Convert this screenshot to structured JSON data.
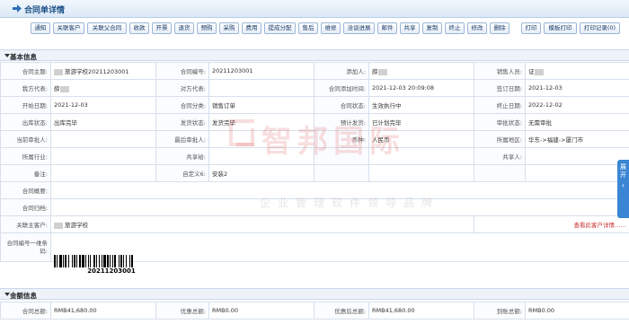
{
  "header": {
    "title": "合同单详情"
  },
  "toolbar": {
    "buttons": [
      "通知",
      "关联客户",
      "关联父合同",
      "收款",
      "开票",
      "退货",
      "预购",
      "采购",
      "费用",
      "提成分配",
      "售后",
      "维修",
      "洽谈进展",
      "邮件",
      "共享",
      "复制",
      "终止",
      "修改",
      "删除",
      "打印",
      "模板打印",
      "打印记录(0)"
    ]
  },
  "basic": {
    "section_label": "基本信息",
    "rows": [
      [
        [
          "合同主题:",
          "旅游学校20211203001"
        ],
        [
          "合同编号:",
          "20211203001"
        ],
        [
          "添加人:",
          "薛"
        ],
        [
          "销售人员:",
          "证"
        ]
      ],
      [
        [
          "我方代表:",
          "薛"
        ],
        [
          "对方代表:",
          ""
        ],
        [
          "合同添加时间:",
          "2021-12-03 20:09:08"
        ],
        [
          "签订日期:",
          "2021-12-03"
        ]
      ],
      [
        [
          "开始日期:",
          "2021-12-03"
        ],
        [
          "合同分类:",
          "销售订单"
        ],
        [
          "合同状态:",
          "生效执行中"
        ],
        [
          "终止日期:",
          "2022-12-02"
        ]
      ],
      [
        [
          "出库状态:",
          "出库完毕"
        ],
        [
          "发货状态:",
          "发货完毕"
        ],
        [
          "预计发货:",
          "已计划完毕"
        ],
        [
          "审批状态:",
          "无需审批"
        ]
      ],
      [
        [
          "当前审批人:",
          ""
        ],
        [
          "最后审批人:",
          ""
        ],
        [
          "币种:",
          "人民币"
        ],
        [
          "所属地区:",
          "华东->福建->厦门市"
        ]
      ],
      [
        [
          "所属行业:",
          ""
        ],
        [
          "共享给:",
          ""
        ],
        [
          "",
          ""
        ],
        [
          "共享人:",
          ""
        ]
      ],
      [
        [
          "备注:",
          ""
        ],
        [
          "自定义6:",
          "安装2"
        ],
        [
          "",
          ""
        ],
        [
          "",
          ""
        ]
      ]
    ],
    "wide_rows": [
      {
        "label": "合同概要:",
        "value": ""
      },
      {
        "label": "合同归档:",
        "value": ""
      }
    ],
    "customer_row": {
      "label": "关联主客户:",
      "value": "旅游学校",
      "link": "查看此客户详情……"
    },
    "barcode_row": {
      "label": "合同编号一维条码:",
      "value": "20211203001"
    }
  },
  "amount": {
    "section_label": "金额信息",
    "row": [
      [
        "合同总额:",
        "RMB41,680.00"
      ],
      [
        "优惠总额:",
        "RMB0.00"
      ],
      [
        "优惠后总额:",
        "RMB41,680.00"
      ],
      [
        "到账总额:",
        "RMB0.00"
      ]
    ]
  },
  "watermark": {
    "main": "智邦国际",
    "sub": "企业管理软件领导品牌"
  },
  "sidetab": {
    "label": "展开"
  },
  "colors": {
    "title": "#1b4f86",
    "link": "#c9302c",
    "sidetab": "#3b86d4"
  }
}
